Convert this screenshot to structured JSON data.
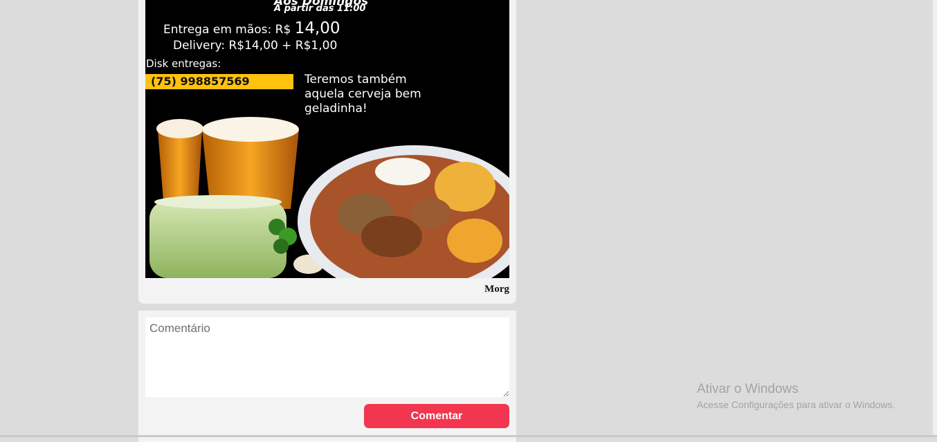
{
  "post": {
    "flyer": {
      "header_partial": "Aos Domingos",
      "time_line": "A partir das 11:00",
      "hand_delivery_label": "Entrega em mãos: R$",
      "hand_delivery_price": "14,00",
      "delivery_line": "Delivery: R$14,00 + R$1,00",
      "disk_label": "Disk entregas:",
      "phone": "(75) 998857569",
      "beer_line_1": "Teremos também",
      "beer_line_2": "aquela cerveja bem",
      "beer_line_3": "geladinha!"
    },
    "author": "Morg"
  },
  "comment": {
    "placeholder": "Comentário",
    "button_label": "Comentar"
  },
  "watermark": {
    "title": "Ativar o Windows",
    "subtitle": "Acesse Configurações para ativar o Windows."
  },
  "colors": {
    "page_bg": "#dcdcdc",
    "card_bg": "#f3f3f3",
    "accent_button": "#f2364f",
    "phone_highlight": "#ffc20e"
  }
}
